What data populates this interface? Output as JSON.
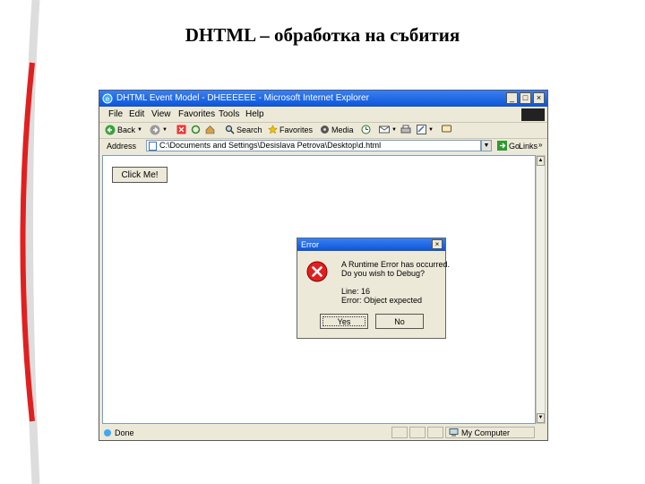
{
  "slide": {
    "title": "DHTML – обработка на събития"
  },
  "browser": {
    "title": "DHTML Event Model - DHEEEEEE - Microsoft Internet Explorer",
    "menu": [
      "File",
      "Edit",
      "View",
      "Favorites",
      "Tools",
      "Help"
    ],
    "toolbar": {
      "back": "Back",
      "search": "Search",
      "favorites": "Favorites",
      "media": "Media"
    },
    "address": {
      "label": "Address",
      "value": "C:\\Documents and Settings\\Desislava Petrova\\Desktop\\d.html",
      "go": "Go",
      "links": "Links"
    },
    "status": {
      "text": "Done",
      "zone": "My Computer"
    }
  },
  "page": {
    "button_label": "Click Me!"
  },
  "dialog": {
    "title": "Error",
    "line1": "A Runtime Error has occurred.",
    "line2": "Do you wish to Debug?",
    "line3": "Line: 16",
    "line4": "Error: Object expected",
    "yes": "Yes",
    "no": "No"
  },
  "colors": {
    "titlebar": "#0a54d8",
    "accent_red": "#e02020",
    "chrome": "#ece9d8"
  }
}
